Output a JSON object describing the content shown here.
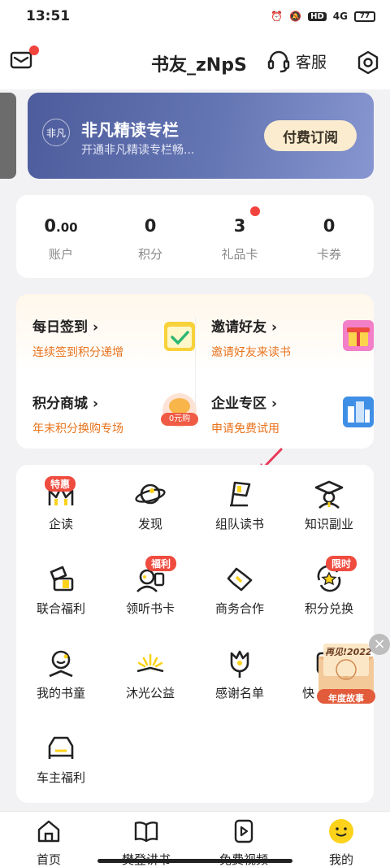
{
  "status_bar": {
    "time": "13:51",
    "hd": "HD",
    "net": "4G",
    "battery": "77"
  },
  "header": {
    "title": "书友_zNpS",
    "service_label": "客服"
  },
  "banner": {
    "logo_text": "非凡",
    "title": "非凡精读专栏",
    "subtitle": "开通非凡精读专栏畅...",
    "button": "付费订阅"
  },
  "stats": [
    {
      "value_int": "0",
      "value_dec": ".00",
      "label": "账户"
    },
    {
      "value_int": "0",
      "value_dec": "",
      "label": "积分"
    },
    {
      "value_int": "3",
      "value_dec": "",
      "label": "礼品卡"
    },
    {
      "value_int": "0",
      "value_dec": "",
      "label": "卡券"
    }
  ],
  "tasks": [
    {
      "title": "每日签到",
      "sub": "连续签到积分递增",
      "icon": "calendar-check-icon",
      "icon_color": "#f7d23a"
    },
    {
      "title": "邀请好友",
      "sub": "邀请好友来读书",
      "icon": "gift-icon",
      "icon_color": "#f27fc7"
    },
    {
      "title": "积分商城",
      "sub": "年末积分换购专场",
      "icon": "coin-badge-icon",
      "icon_color": "#f58a6c",
      "icon_text": "0元购"
    },
    {
      "title": "企业专区",
      "sub": "申请免费试用",
      "icon": "building-icon",
      "icon_color": "#3f8fe6"
    }
  ],
  "grid": [
    {
      "label": "企读",
      "icon": "enterprise-read-icon",
      "badge": "特惠"
    },
    {
      "label": "发现",
      "icon": "planet-icon",
      "badge": ""
    },
    {
      "label": "组队读书",
      "icon": "flag-icon",
      "badge": ""
    },
    {
      "label": "知识副业",
      "icon": "graduate-icon",
      "badge": ""
    },
    {
      "label": "联合福利",
      "icon": "gift-box-icon",
      "badge": ""
    },
    {
      "label": "领听书卡",
      "icon": "headphone-person-icon",
      "badge": "福利"
    },
    {
      "label": "商务合作",
      "icon": "handshake-icon",
      "badge": ""
    },
    {
      "label": "积分兑换",
      "icon": "exchange-star-icon",
      "badge": "限时"
    },
    {
      "label": "我的书童",
      "icon": "book-boy-icon",
      "badge": ""
    },
    {
      "label": "沐光公益",
      "icon": "sunrise-book-icon",
      "badge": ""
    },
    {
      "label": "感谢名单",
      "icon": "flower-icon",
      "badge": ""
    },
    {
      "label": "快",
      "icon": "quick-icon",
      "badge": ""
    },
    {
      "label": "车主福利",
      "icon": "car-icon",
      "badge": ""
    }
  ],
  "promo": {
    "top_text": "再见!2022",
    "bottom_text": "年度故事"
  },
  "bottom_nav": [
    {
      "label": "首页",
      "icon": "home-icon"
    },
    {
      "label": "樊登讲书",
      "icon": "book-open-icon"
    },
    {
      "label": "免费视频",
      "icon": "video-icon"
    },
    {
      "label": "我的",
      "icon": "smile-face-icon"
    }
  ],
  "colors": {
    "accent_orange": "#e8731d",
    "badge_red": "#ef4b3f",
    "banner_blue": "#5a69a8",
    "brand_yellow": "#fcd21b"
  }
}
